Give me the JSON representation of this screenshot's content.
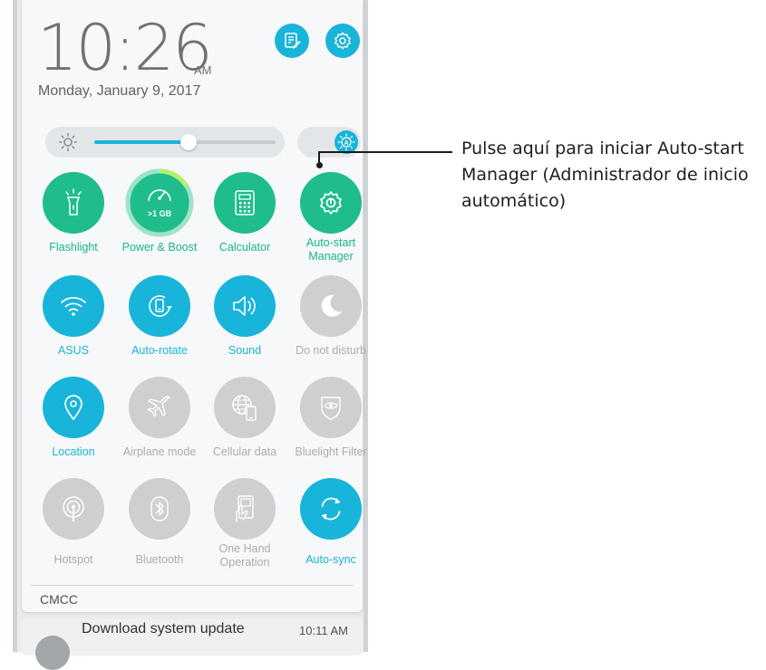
{
  "clock": {
    "time": "10:26",
    "ampm": "AM",
    "date": "Monday, January 9, 2017"
  },
  "header": {
    "notes_icon": "edit-notes-icon",
    "settings_icon": "settings-gear-icon"
  },
  "brightness": {
    "level_percent": 52,
    "auto_icon": "auto-brightness-icon"
  },
  "tiles": [
    {
      "label": "Flashlight",
      "icon": "flashlight-icon",
      "state": "on"
    },
    {
      "label": "Power & Boost",
      "icon": "speedometer-icon",
      "badge": ">1 GB",
      "state": "on"
    },
    {
      "label": "Calculator",
      "icon": "calculator-icon",
      "state": "on"
    },
    {
      "label": "Auto-start Manager",
      "icon": "gear-icon",
      "state": "on"
    },
    {
      "label": "ASUS",
      "icon": "wifi-icon",
      "state": "on"
    },
    {
      "label": "Auto-rotate",
      "icon": "rotate-icon",
      "state": "on"
    },
    {
      "label": "Sound",
      "icon": "speaker-icon",
      "state": "on"
    },
    {
      "label": "Do not disturb",
      "icon": "moon-icon",
      "state": "off"
    },
    {
      "label": "Location",
      "icon": "location-pin-icon",
      "state": "on"
    },
    {
      "label": "Airplane mode",
      "icon": "airplane-icon",
      "state": "off"
    },
    {
      "label": "Cellular data",
      "icon": "globe-phone-icon",
      "state": "off"
    },
    {
      "label": "Bluelight Filter",
      "icon": "eye-filter-icon",
      "state": "off"
    },
    {
      "label": "Hotspot",
      "icon": "hotspot-icon",
      "state": "off"
    },
    {
      "label": "Bluetooth",
      "icon": "bluetooth-icon",
      "state": "off"
    },
    {
      "label": "One Hand Operation",
      "icon": "one-hand-icon",
      "state": "off"
    },
    {
      "label": "Auto-sync",
      "icon": "sync-icon",
      "state": "on"
    }
  ],
  "carrier": "CMCC",
  "notification": {
    "title": "Download system update",
    "time": "10:11 AM"
  },
  "callout": {
    "text": "Pulse aquí para iniciar Auto-start Manager (Administrador de inicio automático)"
  },
  "colors": {
    "accent_blue": "#19b4d9",
    "accent_green": "#1fbc8c",
    "inactive_grey": "#cdcfd1"
  }
}
